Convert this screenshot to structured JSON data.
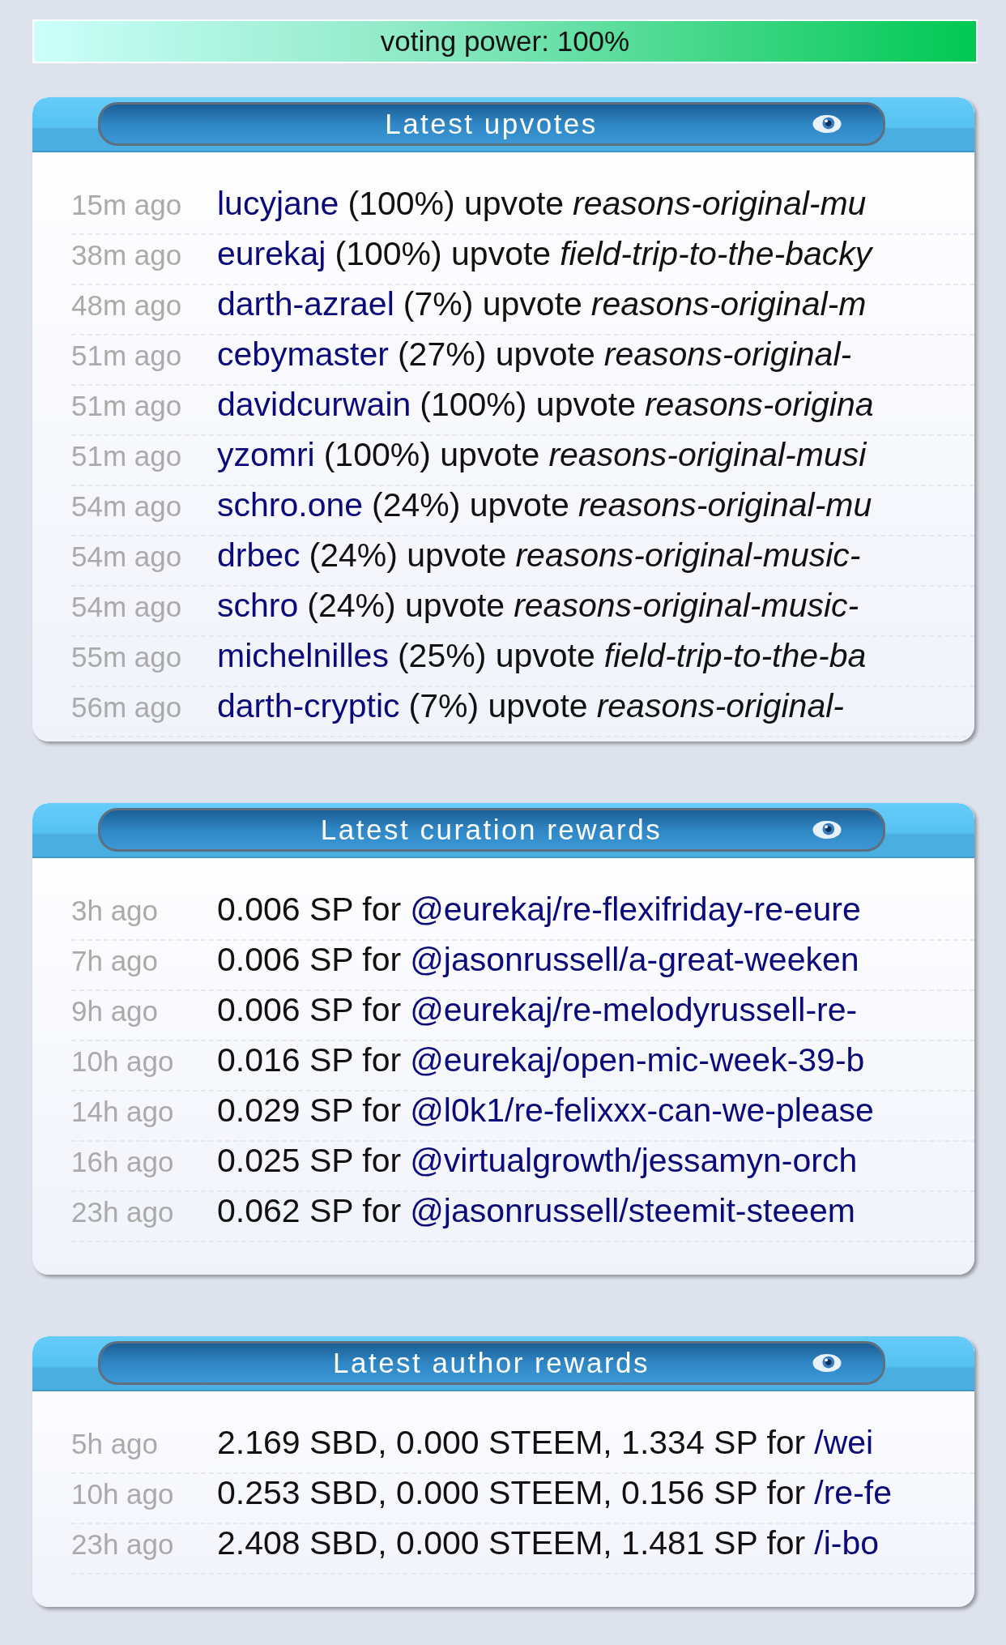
{
  "voting_power": {
    "label": "voting power: 100%",
    "level": 1.0
  },
  "panels": [
    {
      "kind": "upvotes",
      "title": "Latest upvotes",
      "rows": [
        {
          "time": "15m ago",
          "voter": "lucyjane",
          "detail": "(100%) upvote",
          "post": "reasons-original-mu"
        },
        {
          "time": "38m ago",
          "voter": "eurekaj",
          "detail": "(100%) upvote",
          "post": "field-trip-to-the-backy"
        },
        {
          "time": "48m ago",
          "voter": "darth-azrael",
          "detail": "(7%) upvote",
          "post": "reasons-original-m"
        },
        {
          "time": "51m ago",
          "voter": "cebymaster",
          "detail": "(27%) upvote",
          "post": "reasons-original-"
        },
        {
          "time": "51m ago",
          "voter": "davidcurwain",
          "detail": "(100%) upvote",
          "post": "reasons-origina"
        },
        {
          "time": "51m ago",
          "voter": "yzomri",
          "detail": "(100%) upvote",
          "post": "reasons-original-musi"
        },
        {
          "time": "54m ago",
          "voter": "schro.one",
          "detail": "(24%) upvote",
          "post": "reasons-original-mu"
        },
        {
          "time": "54m ago",
          "voter": "drbec",
          "detail": "(24%) upvote",
          "post": "reasons-original-music-"
        },
        {
          "time": "54m ago",
          "voter": "schro",
          "detail": "(24%) upvote",
          "post": "reasons-original-music-"
        },
        {
          "time": "55m ago",
          "voter": "michelnilles",
          "detail": "(25%) upvote",
          "post": "field-trip-to-the-ba"
        },
        {
          "time": "56m ago",
          "voter": "darth-cryptic",
          "detail": "(7%) upvote",
          "post": "reasons-original-"
        }
      ]
    },
    {
      "kind": "rewards",
      "title": "Latest curation rewards",
      "rows": [
        {
          "time": "3h ago",
          "amount": "0.006 SP for",
          "link": "@eurekaj/re-flexifriday-re-eure"
        },
        {
          "time": "7h ago",
          "amount": "0.006 SP for",
          "link": "@jasonrussell/a-great-weeken"
        },
        {
          "time": "9h ago",
          "amount": "0.006 SP for",
          "link": "@eurekaj/re-melodyrussell-re-"
        },
        {
          "time": "10h ago",
          "amount": "0.016 SP for",
          "link": "@eurekaj/open-mic-week-39-b"
        },
        {
          "time": "14h ago",
          "amount": "0.029 SP for",
          "link": "@l0k1/re-felixxx-can-we-please"
        },
        {
          "time": "16h ago",
          "amount": "0.025 SP for",
          "link": "@virtualgrowth/jessamyn-orch"
        },
        {
          "time": "23h ago",
          "amount": "0.062 SP for",
          "link": "@jasonrussell/steemit-steeem"
        }
      ]
    },
    {
      "kind": "rewards",
      "title": "Latest author rewards",
      "rows": [
        {
          "time": "5h ago",
          "amount": "2.169 SBD, 0.000 STEEM, 1.334 SP for",
          "link": "/wei"
        },
        {
          "time": "10h ago",
          "amount": "0.253 SBD, 0.000 STEEM, 0.156 SP for",
          "link": "/re-fe"
        },
        {
          "time": "23h ago",
          "amount": "2.408 SBD, 0.000 STEEM, 1.481 SP for",
          "link": "/i-bo"
        }
      ]
    }
  ]
}
